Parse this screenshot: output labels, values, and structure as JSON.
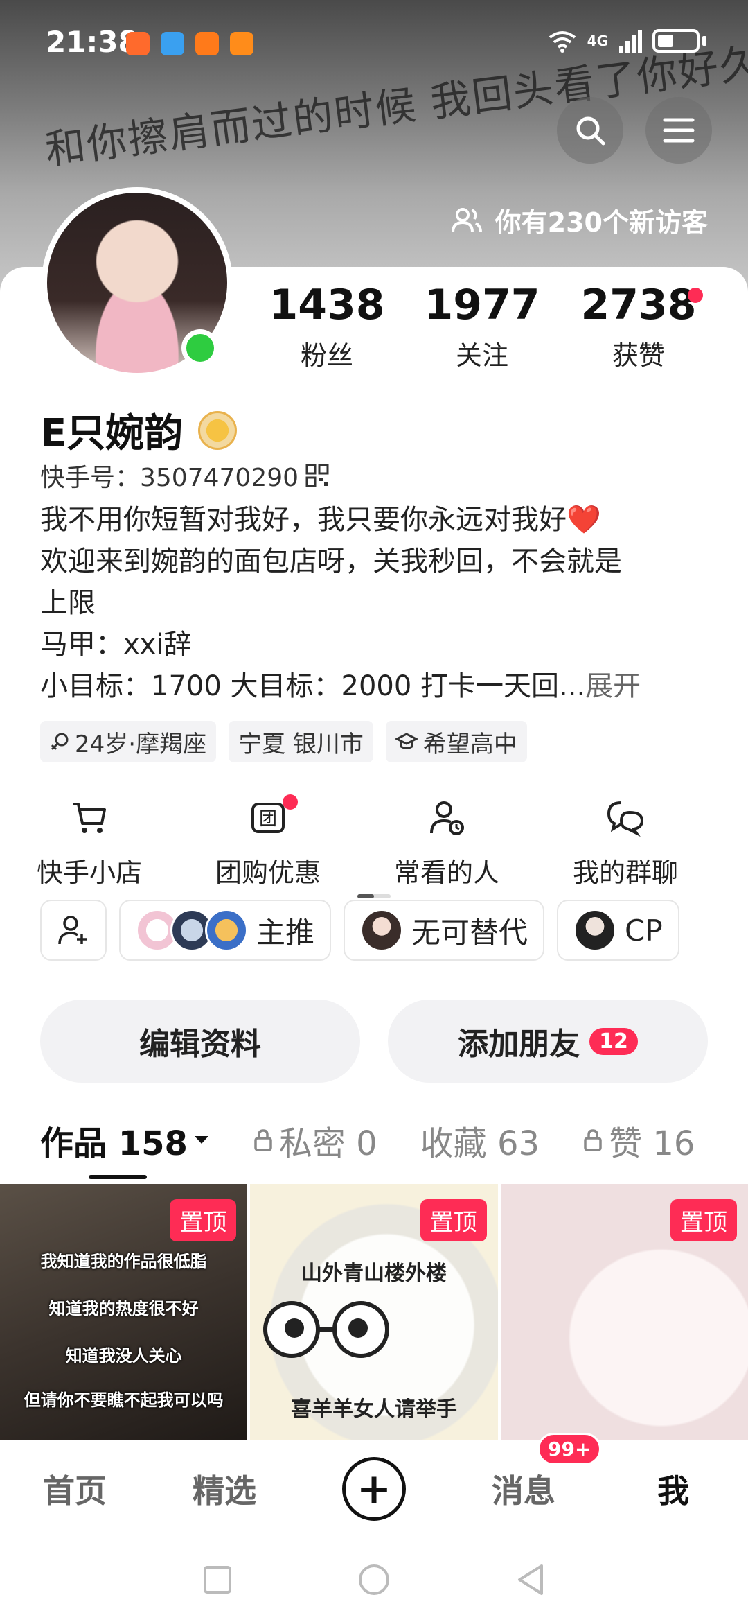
{
  "status_bar": {
    "time": "21:38",
    "network": "4G",
    "app_icon_colors": [
      "#ff6a2c",
      "#3aa0f0",
      "#ff7a1a",
      "#ff8c1a"
    ]
  },
  "banner": {
    "text": "和你擦肩而过的时候 我回头看了你好久",
    "visitors": "你有230个新访客"
  },
  "profile": {
    "stats": [
      {
        "num": "1438",
        "label": "粉丝"
      },
      {
        "num": "1977",
        "label": "关注"
      },
      {
        "num": "2738",
        "label": "获赞"
      }
    ],
    "name": "E只婉韵",
    "kuaishou_id": "快手号：3507470290",
    "bio": [
      "我不用你短暂对我好，我只要你永远对我好❤️",
      "欢迎来到婉韵的面包店呀，关我秒回，不会就是",
      "上限",
      "马甲：xxi辞",
      "小目标：1700 大目标：2000 打卡一天回..."
    ],
    "bio_more": "展开",
    "tags": [
      "24岁·摩羯座",
      "宁夏 银川市",
      "希望高中"
    ]
  },
  "shortcuts": [
    {
      "label": "快手小店",
      "icon": "cart-icon"
    },
    {
      "label": "团购优惠",
      "icon": "group-buy-icon"
    },
    {
      "label": "常看的人",
      "icon": "person-clock-icon"
    },
    {
      "label": "我的群聊",
      "icon": "chat-bubbles-icon"
    }
  ],
  "chips": [
    "主推",
    "无可替代",
    "CP"
  ],
  "actions": {
    "edit": "编辑资料",
    "add_friend": "添加朋友",
    "add_friend_count": "12"
  },
  "tabs": [
    {
      "label": "作品 158",
      "active": true
    },
    {
      "label": "私密 0"
    },
    {
      "label": "收藏 63"
    },
    {
      "label": "赞 16"
    }
  ],
  "grid": {
    "pin_label": "置顶",
    "tile1_lines": [
      "我知道我的作品很低脂",
      "知道我的热度很不好",
      "知道我没人关心",
      "但请你不要瞧不起我可以吗"
    ],
    "tile2_top": "山外青山楼外楼",
    "tile2_bottom": "喜羊羊女人请举手"
  },
  "bottom_nav": {
    "home": "首页",
    "featured": "精选",
    "messages": "消息",
    "messages_badge": "99+",
    "me": "我"
  },
  "colors": {
    "accent": "#fe2c55",
    "online": "#2ecc40"
  }
}
